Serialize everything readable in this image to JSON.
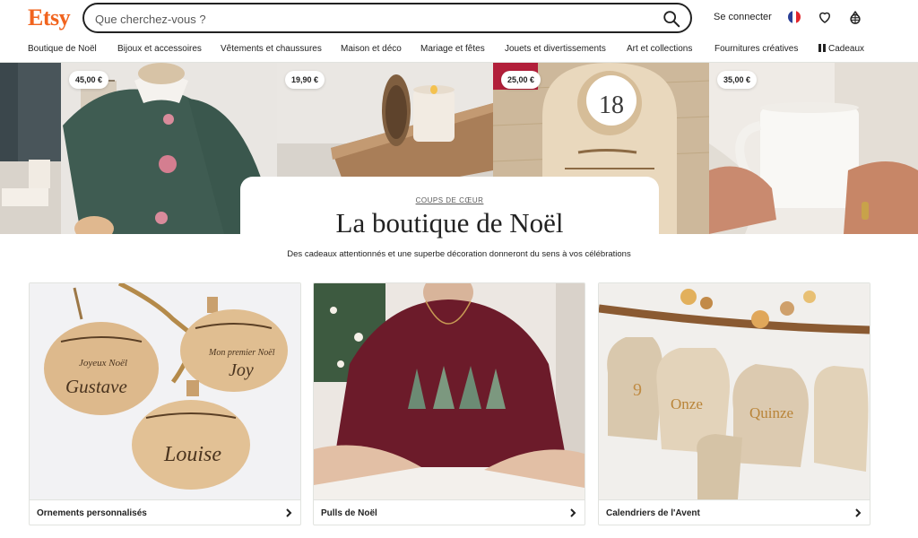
{
  "brand": {
    "logo": "Etsy",
    "accent": "#F1641E"
  },
  "search": {
    "placeholder": "Que cherchez-vous ?",
    "icon": "search-icon"
  },
  "header": {
    "signin": "Se connecter",
    "icons": [
      "fr-flag-icon",
      "heart-icon",
      "basket-icon"
    ]
  },
  "nav": {
    "items": [
      "Boutique de Noël",
      "Bijoux et accessoires",
      "Vêtements et chaussures",
      "Maison et déco",
      "Mariage et fêtes",
      "Jouets et divertissements",
      "Art et collections",
      "Fournitures créatives",
      "Cadeaux"
    ]
  },
  "hero": {
    "prices": [
      "45,00 €",
      "19,90 €",
      "25,00 €",
      "35,00 €"
    ],
    "tiles": [
      "green-sweater-photo",
      "candle-photo",
      "wooden-calendar-photo",
      "white-mug-photo"
    ],
    "calendar_number": "18"
  },
  "feature": {
    "kicker": "COUPS DE CŒUR",
    "title": "La boutique de Noël",
    "subtitle": "Des cadeaux attentionnés et une superbe décoration donneront du sens à vos célébrations"
  },
  "cards": [
    {
      "label": "Ornements personnalisés",
      "image": "wooden-ornaments-photo",
      "ornament_names": [
        "Gustave",
        "Joy",
        "Louise"
      ]
    },
    {
      "label": "Pulls de Noël",
      "image": "burgundy-sweater-photo"
    },
    {
      "label": "Calendriers de l'Avent",
      "image": "advent-bags-photo",
      "bag_labels": [
        "9",
        "Onze",
        "Quinze"
      ]
    }
  ]
}
